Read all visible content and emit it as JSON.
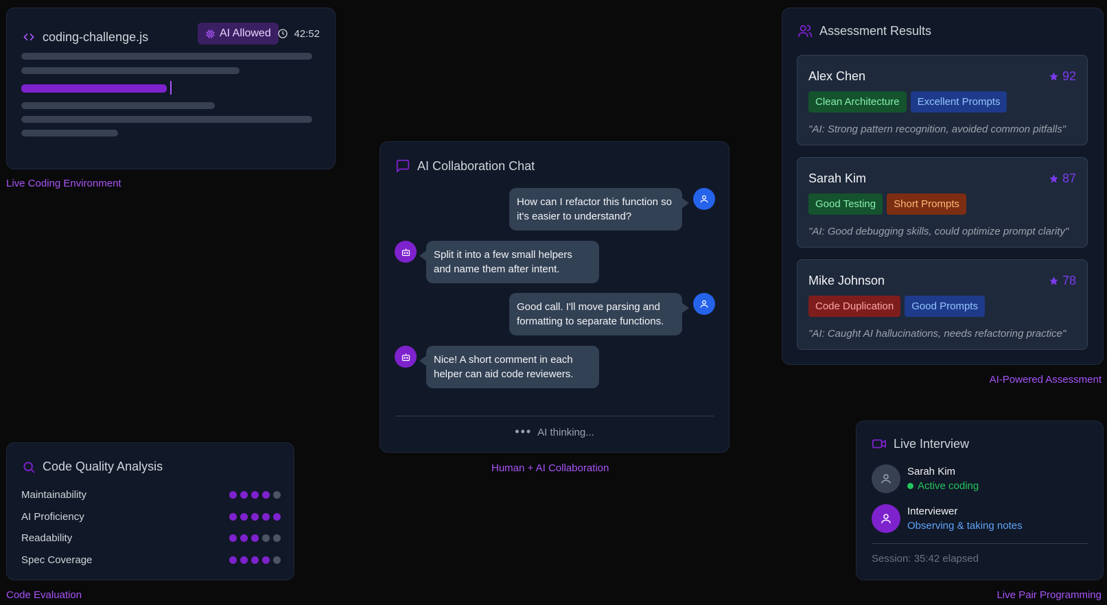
{
  "editor": {
    "filename": "coding-challenge.js",
    "badge": "AI Allowed",
    "timer": "42:52",
    "caption": "Live Coding Environment"
  },
  "chat": {
    "title": "AI Collaboration Chat",
    "messages": [
      {
        "role": "user",
        "text": "How can I refactor this function so it's easier to understand?"
      },
      {
        "role": "ai",
        "text": "Split it into a few small helpers and name them after intent."
      },
      {
        "role": "user",
        "text": "Good call. I'll move parsing and formatting to separate functions."
      },
      {
        "role": "ai",
        "text": "Nice! A short comment in each helper can aid code reviewers."
      }
    ],
    "status": "AI thinking...",
    "caption": "Human + AI Collaboration"
  },
  "assessment": {
    "title": "Assessment Results",
    "caption": "AI-Powered Assessment",
    "results": [
      {
        "name": "Alex Chen",
        "score": "92",
        "tags": [
          "Clean Architecture",
          "Excellent Prompts"
        ],
        "note": "\"AI: Strong pattern recognition, avoided common pitfalls\""
      },
      {
        "name": "Sarah Kim",
        "score": "87",
        "tags": [
          "Good Testing",
          "Short Prompts"
        ],
        "note": "\"AI: Good debugging skills, could optimize prompt clarity\""
      },
      {
        "name": "Mike Johnson",
        "score": "78",
        "tags": [
          "Code Duplication",
          "Good Prompts"
        ],
        "note": "\"AI: Caught AI hallucinations, needs refactoring practice\""
      }
    ]
  },
  "quality": {
    "title": "Code Quality Analysis",
    "caption": "Code Evaluation",
    "metrics": [
      {
        "label": "Maintainability",
        "rating": 4,
        "max": 5
      },
      {
        "label": "AI Proficiency",
        "rating": 5,
        "max": 5
      },
      {
        "label": "Readability",
        "rating": 3,
        "max": 5
      },
      {
        "label": "Spec Coverage",
        "rating": 4,
        "max": 5
      }
    ]
  },
  "interview": {
    "title": "Live Interview",
    "caption": "Live Pair Programming",
    "participants": [
      {
        "name": "Sarah Kim",
        "status": "Active coding"
      },
      {
        "name": "Interviewer",
        "status": "Observing & taking notes"
      }
    ],
    "session": "Session: 35:42 elapsed"
  },
  "colors": {
    "accent": "#7e22ce",
    "user_avatar": "#2563eb",
    "active_status": "#22c55e",
    "observer_status": "#60a5fa"
  }
}
